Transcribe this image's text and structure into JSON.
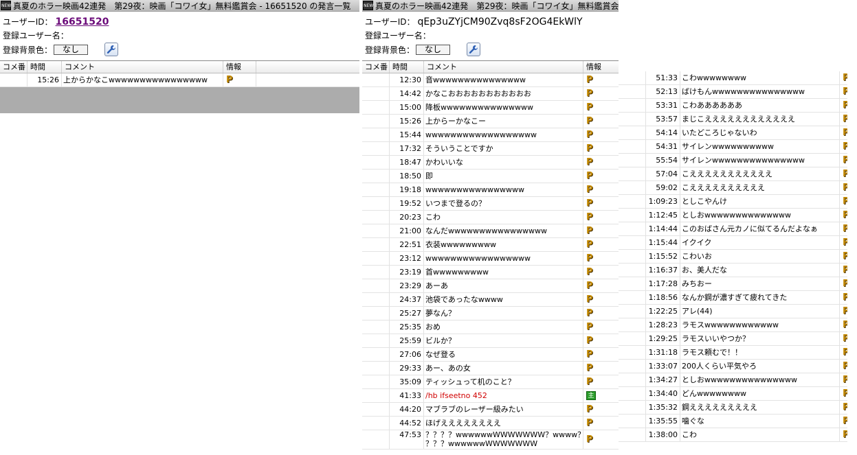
{
  "window1": {
    "title": "真夏のホラー映画42連発　第29夜：映画「コワイ女」無料鑑賞会 - 16651520 の発言一覧",
    "userid_label": "ユーザーID：",
    "userid": "16651520",
    "username_label": "登録ユーザー名：",
    "bg_label": "登録背景色：",
    "bg_value": "なし",
    "columns": [
      "コメ番",
      "時間",
      "コメント",
      "情報"
    ],
    "rows": [
      {
        "num": "",
        "time": "15:26",
        "comment": "上からかなこwwwwwwwwwwwwwwww",
        "info": "P"
      }
    ]
  },
  "window2": {
    "title": "真夏のホラー映画42連発　第29夜：映画「コワイ女」無料鑑賞会",
    "userid_label": "ユーザーID：",
    "userid": "qEp3uZYjCM90Zvq8sF2OG4EkWlY",
    "username_label": "登録ユーザー名：",
    "bg_label": "登録背景色：",
    "bg_value": "なし",
    "columns": [
      "コメ番",
      "時間",
      "コメント",
      "情報"
    ],
    "rows": [
      {
        "time": "12:30",
        "comment": "音wwwwwwwwwwwwwww",
        "info": "P"
      },
      {
        "time": "14:42",
        "comment": "かなこおおおおおおおおおおお",
        "info": "P"
      },
      {
        "time": "15:00",
        "comment": "降板wwwwwwwwwwwwwww",
        "info": "P"
      },
      {
        "time": "15:26",
        "comment": "上からーかなこー",
        "info": "P"
      },
      {
        "time": "15:44",
        "comment": "wwwwwwwwwwwwwwwwww",
        "info": "P"
      },
      {
        "time": "17:32",
        "comment": "そういうことですか",
        "info": "P"
      },
      {
        "time": "18:47",
        "comment": "かわいいな",
        "info": "P"
      },
      {
        "time": "18:50",
        "comment": "即",
        "info": "P"
      },
      {
        "time": "19:18",
        "comment": "wwwwwwwwwwwwwwww",
        "info": "P"
      },
      {
        "time": "19:52",
        "comment": "いつまで登るの？",
        "info": "P"
      },
      {
        "time": "20:23",
        "comment": "こわ",
        "info": "P"
      },
      {
        "time": "21:00",
        "comment": "なんだwwwwwwwwwwwwwwww",
        "info": "P"
      },
      {
        "time": "22:51",
        "comment": "衣装wwwwwwwww",
        "info": "P"
      },
      {
        "time": "23:12",
        "comment": "wwwwwwwwwwwwwwwww",
        "info": "P"
      },
      {
        "time": "23:19",
        "comment": "首wwwwwwwww",
        "info": "P"
      },
      {
        "time": "23:29",
        "comment": "あーあ",
        "info": "P"
      },
      {
        "time": "24:37",
        "comment": "池袋であったなwwww",
        "info": "P"
      },
      {
        "time": "25:27",
        "comment": "夢なん？",
        "info": "P"
      },
      {
        "time": "25:35",
        "comment": "おめ",
        "info": "P"
      },
      {
        "time": "25:59",
        "comment": "ビルか？",
        "info": "P"
      },
      {
        "time": "27:06",
        "comment": "なぜ登る",
        "info": "P"
      },
      {
        "time": "29:33",
        "comment": "あー、あの女",
        "info": "P"
      },
      {
        "time": "35:09",
        "comment": "ティッシュって机のこと？",
        "info": "P"
      },
      {
        "time": "41:33",
        "comment": "/hb ifseetno 452",
        "info": "主",
        "red": true
      },
      {
        "time": "44:20",
        "comment": "マブラブのレーザー級みたい",
        "info": "P"
      },
      {
        "time": "44:52",
        "comment": "ほげええええええええ",
        "info": "P"
      },
      {
        "time": "47:53",
        "comment": "？？？？wwwwwwWWWWWWW？wwww？？",
        "comment2": "？？？wwwwwwWWWWWWW",
        "info": "P"
      }
    ]
  },
  "panel3": {
    "rows": [
      {
        "time": "51:33",
        "comment": "こわwwwwwwww",
        "info": "P"
      },
      {
        "time": "52:13",
        "comment": "ばけもんwwwwwwwwwwwwwww",
        "info": "P"
      },
      {
        "time": "53:31",
        "comment": "こわああああああ",
        "info": "P"
      },
      {
        "time": "53:57",
        "comment": "まじこええええええええええええ",
        "info": "P"
      },
      {
        "time": "54:14",
        "comment": "いたどころじゃないわ",
        "info": "P"
      },
      {
        "time": "54:31",
        "comment": "サイレンwwwwwwwwww",
        "info": "P"
      },
      {
        "time": "55:54",
        "comment": "サイレンwwwwwwwwwwwwwww",
        "info": "P"
      },
      {
        "time": "57:04",
        "comment": "こえええええええええええ",
        "info": "P"
      },
      {
        "time": "59:02",
        "comment": "こええええええええええ",
        "info": "P"
      },
      {
        "time": "1:09:23",
        "comment": "としこやんけ",
        "info": "P"
      },
      {
        "time": "1:12:45",
        "comment": "としおwwwwwwwwwwwwww",
        "info": "P"
      },
      {
        "time": "1:14:44",
        "comment": "このおばさん元カノに似てるんだよなぁ",
        "info": "P"
      },
      {
        "time": "1:15:44",
        "comment": "イクイク",
        "info": "P"
      },
      {
        "time": "1:15:52",
        "comment": "こわいお",
        "info": "P"
      },
      {
        "time": "1:16:37",
        "comment": "お、美人だな",
        "info": "P"
      },
      {
        "time": "1:17:28",
        "comment": "みちおー",
        "info": "P"
      },
      {
        "time": "1:18:56",
        "comment": "なんか鋼が濃すぎて疲れてきた",
        "info": "P"
      },
      {
        "time": "1:22:25",
        "comment": "アレ(44)",
        "info": "P"
      },
      {
        "time": "1:28:23",
        "comment": "ラモスwwwwwwwwwwww",
        "info": "P"
      },
      {
        "time": "1:29:25",
        "comment": "ラモスいいやつか？",
        "info": "P"
      },
      {
        "time": "1:31:18",
        "comment": "ラモス頼むで！！",
        "info": "P"
      },
      {
        "time": "1:33:07",
        "comment": "200人くらい平気やろ",
        "info": "P"
      },
      {
        "time": "1:34:27",
        "comment": "としおwwwwwwwwwwwwwww",
        "info": "P"
      },
      {
        "time": "1:34:40",
        "comment": "どんwwwwwwww",
        "info": "P"
      },
      {
        "time": "1:35:32",
        "comment": "鋼えええええええええ",
        "info": "P"
      },
      {
        "time": "1:35:55",
        "comment": "噛ぐな",
        "info": "P"
      },
      {
        "time": "1:38:00",
        "comment": "こわ",
        "info": "P"
      }
    ]
  }
}
